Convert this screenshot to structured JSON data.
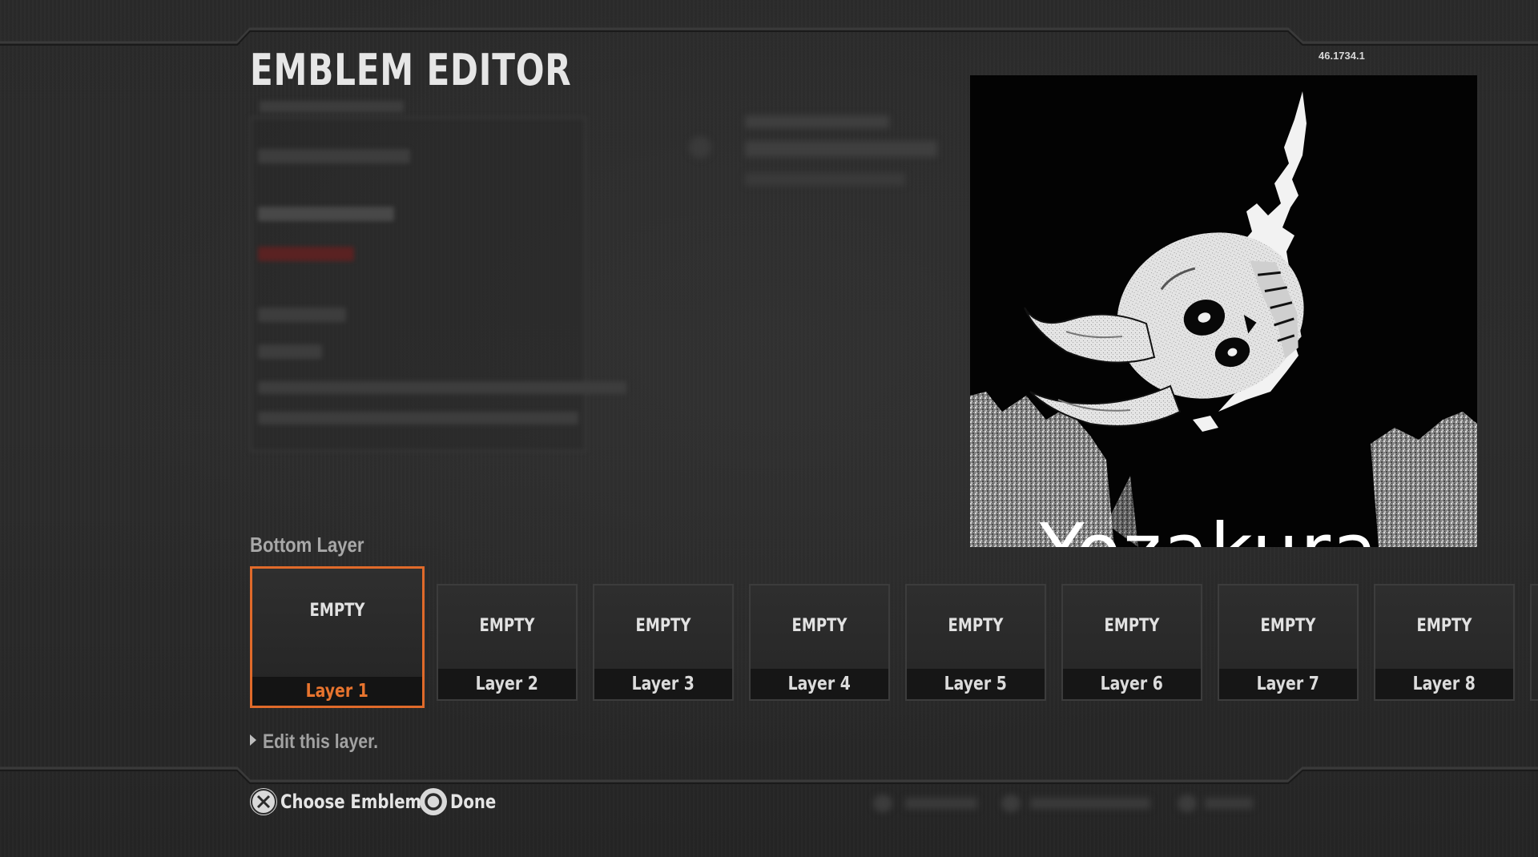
{
  "header": {
    "title": "EMBLEM EDITOR",
    "version": "46.1734.1"
  },
  "emblem": {
    "caption": "Yozakura",
    "artwork": "horned-skull-icon"
  },
  "layers": {
    "section_label": "Bottom Layer",
    "slots": [
      {
        "content": "EMPTY",
        "label": "Layer 1",
        "selected": true
      },
      {
        "content": "EMPTY",
        "label": "Layer 2",
        "selected": false
      },
      {
        "content": "EMPTY",
        "label": "Layer 3",
        "selected": false
      },
      {
        "content": "EMPTY",
        "label": "Layer 4",
        "selected": false
      },
      {
        "content": "EMPTY",
        "label": "Layer 5",
        "selected": false
      },
      {
        "content": "EMPTY",
        "label": "Layer 6",
        "selected": false
      },
      {
        "content": "EMPTY",
        "label": "Layer 7",
        "selected": false
      },
      {
        "content": "EMPTY",
        "label": "Layer 8",
        "selected": false
      }
    ],
    "hint": "Edit this layer."
  },
  "prompts": {
    "choose": {
      "icon": "cross-button-icon",
      "label": "Choose Emblem"
    },
    "done": {
      "icon": "circle-button-icon",
      "label": "Done"
    }
  },
  "colors": {
    "accent": "#e06a2a",
    "background": "#262626",
    "text": "#e4e4e4"
  }
}
